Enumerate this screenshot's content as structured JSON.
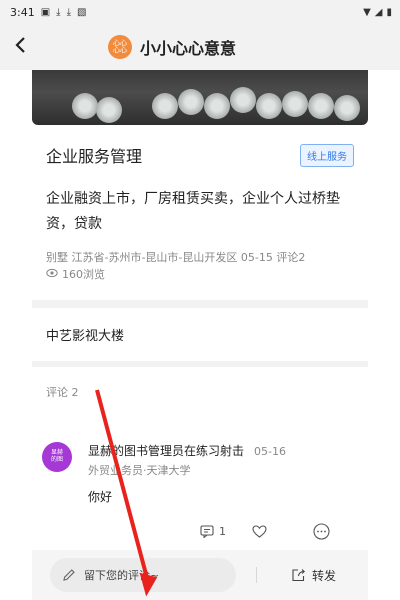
{
  "status_bar": {
    "time": "3:41",
    "icons": [
      "gallery-icon",
      "download-icon",
      "download-icon",
      "app-icon"
    ],
    "right_icons": [
      "wifi-icon",
      "signal-icon",
      "battery-icon"
    ]
  },
  "app_bar": {
    "title": "小小心心意意",
    "avatar_text": "心心\n心心"
  },
  "post": {
    "title": "企业服务管理",
    "tag": "线上服务",
    "description": "企业融资上市，厂房租赁买卖，企业个人过桥垫资，贷款",
    "meta_line": "别墅  江苏省-苏州市-昆山市-昆山开发区  05-15  评论2",
    "views": "160浏览"
  },
  "building": "中艺影视大楼",
  "comments": {
    "header": "评论 2",
    "items": [
      {
        "avatar_text": "显赫\n的图",
        "name": "显赫的图书管理员在练习射击",
        "date": "05-16",
        "subtitle": "外贸业务员·天津大学",
        "text": "你好",
        "reply_count": "1"
      }
    ]
  },
  "bottom_bar": {
    "comment_placeholder": "留下您的评论~",
    "share_label": "转发"
  },
  "colors": {
    "tag_blue": "#2f7be8",
    "avatar_orange": "#f28b3c",
    "avatar_purple": "#a638d6",
    "arrow_red": "#e8231d"
  }
}
